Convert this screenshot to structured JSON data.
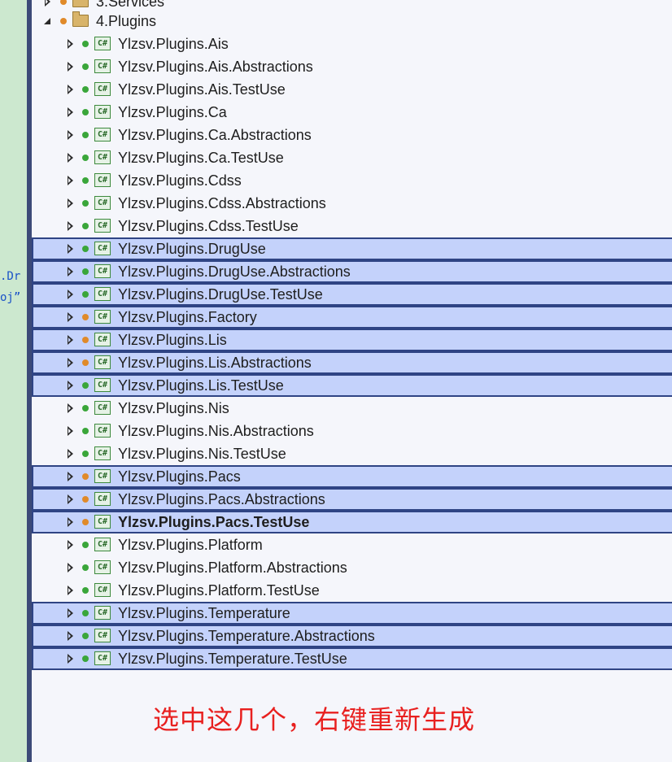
{
  "editor_fragments": [
    ".Dr",
    "oj”"
  ],
  "tree": {
    "folders": [
      {
        "label": "3.Services",
        "state": "collapsed"
      },
      {
        "label": "4.Plugins",
        "state": "expanded"
      }
    ],
    "projects": [
      {
        "label": "Ylzsv.Plugins.Ais",
        "status": "green",
        "selected": false
      },
      {
        "label": "Ylzsv.Plugins.Ais.Abstractions",
        "status": "green",
        "selected": false
      },
      {
        "label": "Ylzsv.Plugins.Ais.TestUse",
        "status": "green",
        "selected": false
      },
      {
        "label": "Ylzsv.Plugins.Ca",
        "status": "green",
        "selected": false
      },
      {
        "label": "Ylzsv.Plugins.Ca.Abstractions",
        "status": "green",
        "selected": false
      },
      {
        "label": "Ylzsv.Plugins.Ca.TestUse",
        "status": "green",
        "selected": false
      },
      {
        "label": "Ylzsv.Plugins.Cdss",
        "status": "green",
        "selected": false
      },
      {
        "label": "Ylzsv.Plugins.Cdss.Abstractions",
        "status": "green",
        "selected": false
      },
      {
        "label": "Ylzsv.Plugins.Cdss.TestUse",
        "status": "green",
        "selected": false
      },
      {
        "label": "Ylzsv.Plugins.DrugUse",
        "status": "green",
        "selected": true
      },
      {
        "label": "Ylzsv.Plugins.DrugUse.Abstractions",
        "status": "green",
        "selected": true
      },
      {
        "label": "Ylzsv.Plugins.DrugUse.TestUse",
        "status": "green",
        "selected": true
      },
      {
        "label": "Ylzsv.Plugins.Factory",
        "status": "orange",
        "selected": true
      },
      {
        "label": "Ylzsv.Plugins.Lis",
        "status": "orange",
        "selected": true
      },
      {
        "label": "Ylzsv.Plugins.Lis.Abstractions",
        "status": "orange",
        "selected": true
      },
      {
        "label": "Ylzsv.Plugins.Lis.TestUse",
        "status": "green",
        "selected": true
      },
      {
        "label": "Ylzsv.Plugins.Nis",
        "status": "green",
        "selected": false
      },
      {
        "label": "Ylzsv.Plugins.Nis.Abstractions",
        "status": "green",
        "selected": false
      },
      {
        "label": "Ylzsv.Plugins.Nis.TestUse",
        "status": "green",
        "selected": false
      },
      {
        "label": "Ylzsv.Plugins.Pacs",
        "status": "orange",
        "selected": true
      },
      {
        "label": "Ylzsv.Plugins.Pacs.Abstractions",
        "status": "orange",
        "selected": true
      },
      {
        "label": "Ylzsv.Plugins.Pacs.TestUse",
        "status": "orange",
        "selected": true,
        "bold": true
      },
      {
        "label": "Ylzsv.Plugins.Platform",
        "status": "green",
        "selected": false
      },
      {
        "label": "Ylzsv.Plugins.Platform.Abstractions",
        "status": "green",
        "selected": false
      },
      {
        "label": "Ylzsv.Plugins.Platform.TestUse",
        "status": "green",
        "selected": false
      },
      {
        "label": "Ylzsv.Plugins.Temperature",
        "status": "green",
        "selected": true
      },
      {
        "label": "Ylzsv.Plugins.Temperature.Abstractions",
        "status": "green",
        "selected": true
      },
      {
        "label": "Ylzsv.Plugins.Temperature.TestUse",
        "status": "green",
        "selected": true
      }
    ],
    "project_icon": "csharp-project-icon",
    "project_icon_text": "C#"
  },
  "annotation": "选中这几个，右键重新生成",
  "colors": {
    "selection_bg": "#c4d2fb",
    "selection_border": "#2f4484",
    "status_green": "#3aa63a",
    "status_orange": "#e08a2a",
    "annotation_red": "#e8201f",
    "editor_bg": "#cce8cf"
  }
}
